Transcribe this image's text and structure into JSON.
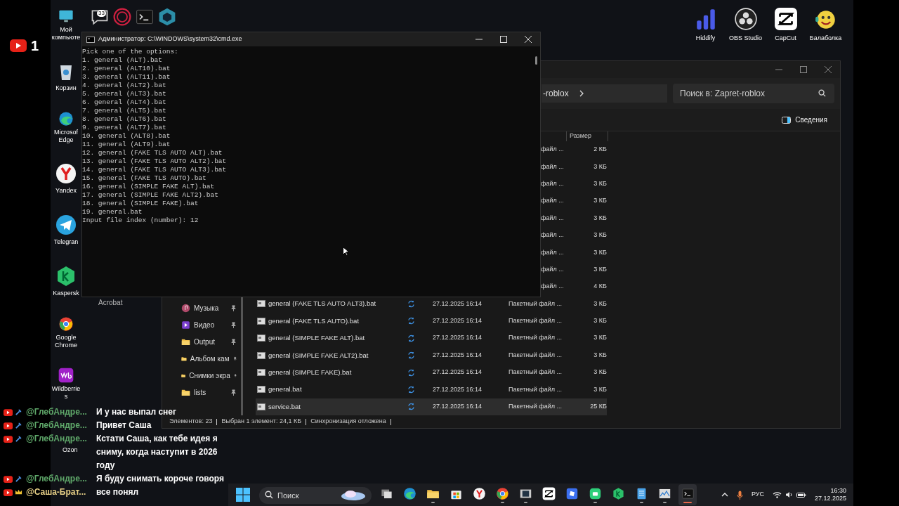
{
  "stream": {
    "viewers": "1"
  },
  "top_icons": [
    {
      "kind": "chat",
      "badge": "33"
    },
    {
      "kind": "ring"
    },
    {
      "kind": "terminal"
    },
    {
      "kind": "cube"
    }
  ],
  "desktop_icons": [
    {
      "kind": "monitor",
      "label": "Мой компьюте"
    },
    {
      "kind": "bin",
      "label": "Корзин"
    },
    {
      "kind": "edge",
      "label": "Microsof Edge"
    },
    {
      "kind": "yandex",
      "label": "Yandex"
    },
    {
      "kind": "telegram",
      "label": "Telegran"
    },
    {
      "kind": "kaspersky",
      "label": "Kaspersk"
    },
    {
      "kind": "chrome",
      "label": "Google Chrome"
    },
    {
      "kind": "wb",
      "label": "Wildberries"
    }
  ],
  "ozon_label": "Ozon",
  "acrobat_label": "Acrobat",
  "right_icons": [
    {
      "kind": "hiddify",
      "label": "Hiddify"
    },
    {
      "kind": "obs",
      "label": "OBS Studio"
    },
    {
      "kind": "capcut",
      "label": "CapCut"
    },
    {
      "kind": "smiley",
      "label": "Балаболка"
    }
  ],
  "cmd": {
    "title": "Администратор: C:\\WINDOWS\\system32\\cmd.exe",
    "lines": [
      "Pick one of the options:",
      "1. general (ALT).bat",
      "2. general (ALT10).bat",
      "3. general (ALT11).bat",
      "4. general (ALT2).bat",
      "5. general (ALT3).bat",
      "6. general (ALT4).bat",
      "7. general (ALT5).bat",
      "8. general (ALT6).bat",
      "9. general (ALT7).bat",
      "10. general (ALT8).bat",
      "11. general (ALT9).bat",
      "12. general (FAKE TLS AUTO ALT).bat",
      "13. general (FAKE TLS AUTO ALT2).bat",
      "14. general (FAKE TLS AUTO ALT3).bat",
      "15. general (FAKE TLS AUTO).bat",
      "16. general (SIMPLE FAKE ALT).bat",
      "17. general (SIMPLE FAKE ALT2).bat",
      "18. general (SIMPLE FAKE).bat",
      "19. general.bat",
      "Input file index (number): 12"
    ]
  },
  "explorer": {
    "address": "-roblox",
    "search": {
      "placeholder": "Поиск в: Zapret-roblox"
    },
    "details_button": "Сведения",
    "column_size": "Размер",
    "sidebar": [
      {
        "kind": "music",
        "label": "Музыка"
      },
      {
        "kind": "video",
        "label": "Видео"
      },
      {
        "kind": "folder",
        "label": "Output"
      },
      {
        "kind": "folder",
        "label": "Альбом кам"
      },
      {
        "kind": "folder",
        "label": "Снимки экра"
      },
      {
        "kind": "folder",
        "label": "lists"
      }
    ],
    "rows": [
      {
        "kind": "partial",
        "type": "файл ...",
        "size": "2 КБ",
        "selected": false
      },
      {
        "kind": "partial",
        "type": "файл ...",
        "size": "3 КБ",
        "selected": false
      },
      {
        "kind": "partial",
        "type": "файл ...",
        "size": "3 КБ",
        "selected": false
      },
      {
        "kind": "partial",
        "type": "файл ...",
        "size": "3 КБ",
        "selected": false
      },
      {
        "kind": "partial",
        "type": "файл ...",
        "size": "3 КБ",
        "selected": false
      },
      {
        "kind": "partial",
        "type": "файл ...",
        "size": "3 КБ",
        "selected": false
      },
      {
        "kind": "partial",
        "type": "файл ...",
        "size": "3 КБ",
        "selected": false
      },
      {
        "kind": "partial",
        "type": "файл ...",
        "size": "3 КБ",
        "selected": false
      },
      {
        "kind": "partial",
        "type": "файл ...",
        "size": "4 КБ",
        "selected": false
      },
      {
        "kind": "full",
        "name": "general (FAKE TLS AUTO ALT3).bat",
        "date": "27.12.2025 16:14",
        "type": "Пакетный файл ...",
        "size": "3 КБ",
        "selected": false
      },
      {
        "kind": "full",
        "name": "general (FAKE TLS AUTO).bat",
        "date": "27.12.2025 16:14",
        "type": "Пакетный файл ...",
        "size": "3 КБ",
        "selected": false
      },
      {
        "kind": "full",
        "name": "general (SIMPLE FAKE ALT).bat",
        "date": "27.12.2025 16:14",
        "type": "Пакетный файл ...",
        "size": "3 КБ",
        "selected": false
      },
      {
        "kind": "full",
        "name": "general (SIMPLE FAKE ALT2).bat",
        "date": "27.12.2025 16:14",
        "type": "Пакетный файл ...",
        "size": "3 КБ",
        "selected": false
      },
      {
        "kind": "full",
        "name": "general (SIMPLE FAKE).bat",
        "date": "27.12.2025 16:14",
        "type": "Пакетный файл ...",
        "size": "3 КБ",
        "selected": false
      },
      {
        "kind": "full",
        "name": "general.bat",
        "date": "27.12.2025 16:14",
        "type": "Пакетный файл ...",
        "size": "3 КБ",
        "selected": false
      },
      {
        "kind": "full",
        "name": "service.bat",
        "date": "27.12.2025 16:14",
        "type": "Пакетный файл ...",
        "size": "25 КБ",
        "selected": true
      }
    ],
    "status": [
      "Элементов: 23",
      "Выбран 1 элемент: 24,1 КБ",
      "Синхронизация отложена"
    ]
  },
  "chat": [
    {
      "kind": "wrench",
      "author": "@ГлебАндре...",
      "color": "#5fa86a",
      "text": "И у нас выпал снег"
    },
    {
      "kind": "wrench",
      "author": "@ГлебАндре...",
      "color": "#5fa86a",
      "text": "Привет Саша"
    },
    {
      "kind": "wrench",
      "author": "@ГлебАндре...",
      "color": "#5fa86a",
      "text": "Кстати Саша, как тебе идея я сниму, когда наступит в 2026 году"
    },
    {
      "kind": "wrench",
      "author": "@ГлебАндре...",
      "color": "#5fa86a",
      "text": "Я буду снимать короче говоря"
    },
    {
      "kind": "crown",
      "author": "@Саша-Брат...",
      "color": "#e6cf86",
      "text": "все понял"
    }
  ],
  "taskbar": {
    "search": {
      "placeholder": "Поиск"
    },
    "apps": [
      {
        "kind": "taskview",
        "running": false,
        "selected": false
      },
      {
        "kind": "edge",
        "running": false,
        "selected": false
      },
      {
        "kind": "folder",
        "running": true,
        "selected": false
      },
      {
        "kind": "store",
        "running": false,
        "selected": false
      },
      {
        "kind": "yandex",
        "running": false,
        "selected": false
      },
      {
        "kind": "chrome",
        "running": true,
        "selected": false
      },
      {
        "kind": "film",
        "running": true,
        "selected": false
      },
      {
        "kind": "capcut",
        "running": false,
        "selected": false
      },
      {
        "kind": "roblox",
        "running": false,
        "selected": false
      },
      {
        "kind": "greenapp",
        "running": true,
        "selected": false
      },
      {
        "kind": "kaspersky",
        "running": false,
        "selected": false
      },
      {
        "kind": "notepad",
        "running": true,
        "selected": false
      },
      {
        "kind": "taskmgr",
        "running": true,
        "selected": false
      },
      {
        "kind": "terminal",
        "running": true,
        "selected": true
      }
    ],
    "language": "РУС",
    "time": "16:30",
    "date": "27.12.2025"
  }
}
